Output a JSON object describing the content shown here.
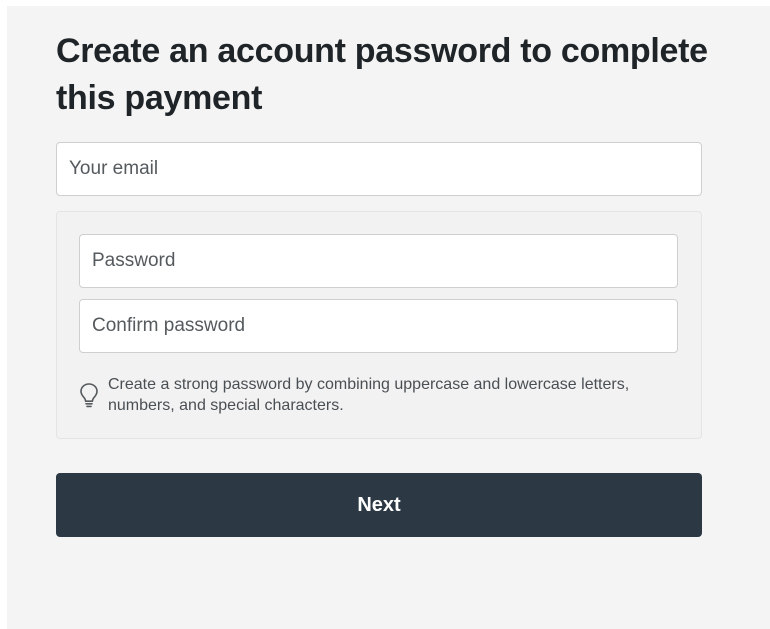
{
  "page": {
    "title": "Create an account password to complete this payment"
  },
  "form": {
    "email": {
      "placeholder": "Your email",
      "value": ""
    },
    "password": {
      "placeholder": "Password",
      "value": ""
    },
    "confirm_password": {
      "placeholder": "Confirm password",
      "value": ""
    },
    "hint": {
      "icon": "lightbulb-icon",
      "text": "Create a strong password by combining uppercase and lowercase letters, numbers, and special characters."
    },
    "next_label": "Next"
  },
  "colors": {
    "panel_background": "#f4f4f4",
    "button_background": "#2c3944",
    "button_text": "#ffffff",
    "field_border": "#cfcfcf"
  }
}
